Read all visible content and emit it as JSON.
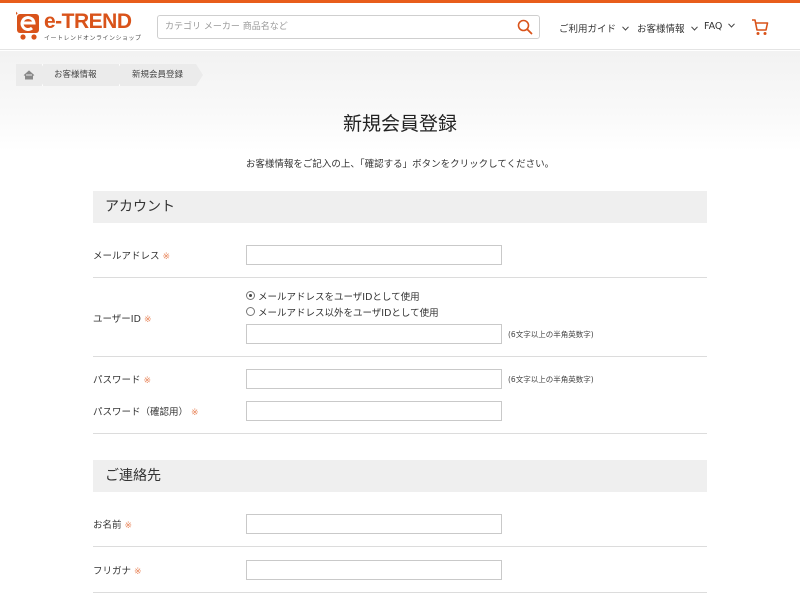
{
  "header": {
    "logo_text": "e-TREND",
    "logo_sub": "イートレンドオンラインショップ",
    "search_placeholder": "カテゴリ メーカー 商品名など",
    "nav": {
      "guide": "ご利用ガイド",
      "customer": "お客様情報",
      "faq": "FAQ"
    }
  },
  "breadcrumb": {
    "customer": "お客様情報",
    "current": "新規会員登録"
  },
  "page": {
    "title": "新規会員登録",
    "instruction": "お客様情報をご記入の上、「確認する」ボタンをクリックしてください。"
  },
  "required_mark": "※",
  "account": {
    "heading": "アカウント",
    "email_label": "メールアドレス",
    "userid_label": "ユーザーID",
    "userid_option_email": "メールアドレスをユーザIDとして使用",
    "userid_option_other": "メールアドレス以外をユーザIDとして使用",
    "userid_hint": "(6文字以上の半角英数字)",
    "password_label": "パスワード",
    "password_hint": "(6文字以上の半角英数字)",
    "password_confirm_label": "パスワード（確認用）"
  },
  "contact": {
    "heading": "ご連絡先",
    "name_label": "お名前",
    "kana_label": "フリガナ"
  },
  "colors": {
    "brand": "#e85d1b",
    "required": "#e8855a",
    "section_bg": "#efefef"
  },
  "icons": [
    "logo-cart-icon",
    "search-icon",
    "chevron-down-icon",
    "cart-icon",
    "home-icon"
  ]
}
